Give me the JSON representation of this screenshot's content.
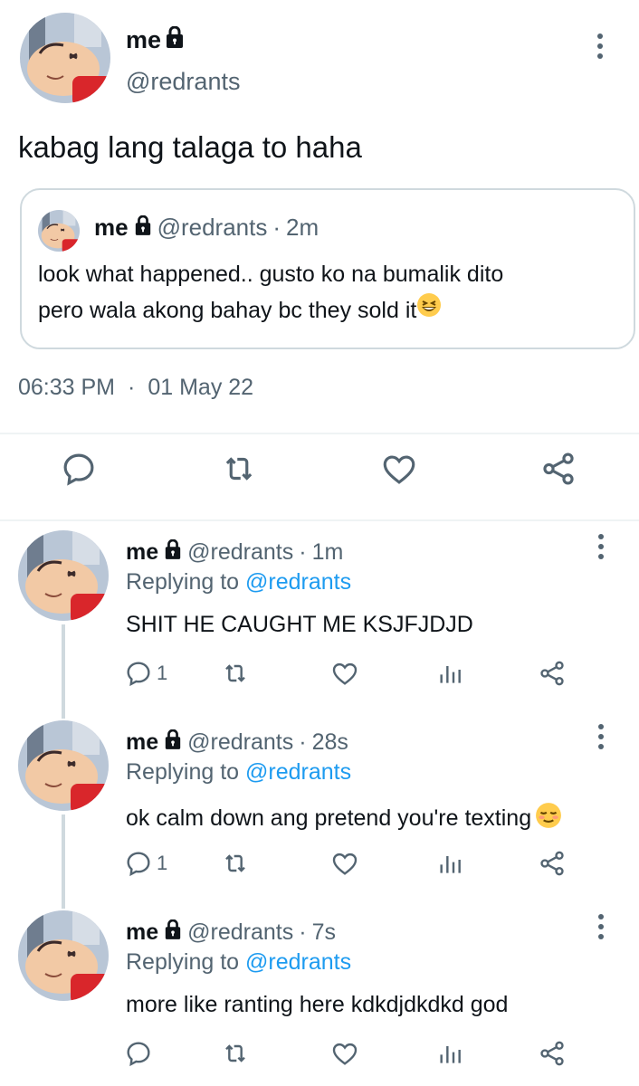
{
  "main_tweet": {
    "name": "me",
    "handle": "@redrants",
    "text": "kabag lang talaga to haha",
    "timestamp_time": "06:33 PM",
    "timestamp_dot": "·",
    "timestamp_date": "01 May 22"
  },
  "quote": {
    "name": "me",
    "handle": "@redrants",
    "separator": "·",
    "time": "2m",
    "line1": "look what happened.. gusto ko na bumalik dito",
    "line2": "pero wala akong bahay bc they sold it",
    "emoji": "grinning-squinting-face"
  },
  "replies": [
    {
      "name": "me",
      "handle": "@redrants",
      "separator": "·",
      "time": "1m",
      "replying_prefix": "Replying to",
      "replying_handle": "@redrants",
      "text": "SHIT HE CAUGHT ME KSJFJDJD",
      "reply_count": "1"
    },
    {
      "name": "me",
      "handle": "@redrants",
      "separator": "·",
      "time": "28s",
      "replying_prefix": "Replying to",
      "replying_handle": "@redrants",
      "text": "ok calm down ang pretend you're texting",
      "emoji": "relieved-face",
      "reply_count": "1"
    },
    {
      "name": "me",
      "handle": "@redrants",
      "separator": "·",
      "time": "7s",
      "replying_prefix": "Replying to",
      "replying_handle": "@redrants",
      "text": "more like ranting here kdkdjdkdkd god",
      "reply_count": ""
    }
  ],
  "colors": {
    "accent": "#1d9bf0",
    "secondary_text": "#536471",
    "primary_text": "#0f1419",
    "border": "#cfd9de"
  }
}
